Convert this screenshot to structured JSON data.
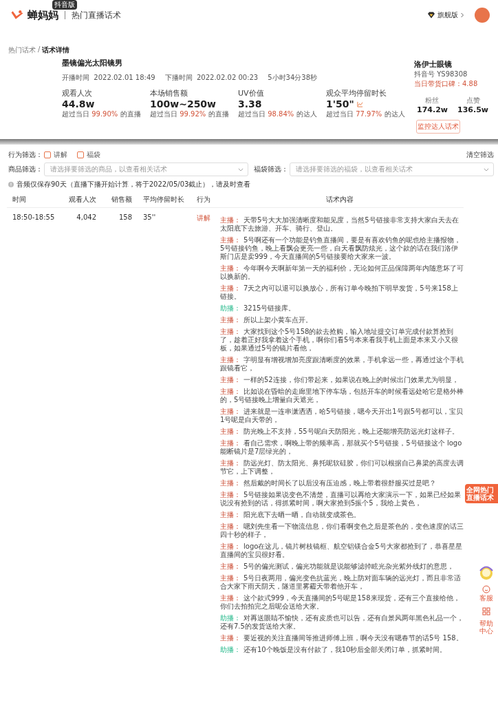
{
  "header": {
    "logo": "蝉妈妈",
    "edition_badge": "抖音版",
    "page_title": "热门直播话术",
    "plan": "旗舰版"
  },
  "breadcrumb": {
    "items": [
      "热门话术",
      "话术详情"
    ],
    "separator": "/"
  },
  "live": {
    "title": "墨镜偏光太阳镜男",
    "start_label": "开播时间",
    "start": "2022.02.01 18:49",
    "end_label": "下播时间",
    "end": "2022.02.02 00:23",
    "duration": "5小时34分38秒"
  },
  "metrics": [
    {
      "label": "观看人次",
      "value": "44.8w",
      "prefix": "超过当日",
      "percent": "99.90%",
      "suffix": "的直播",
      "trend": false
    },
    {
      "label": "本场销售额",
      "value": "100w~250w",
      "prefix": "超过当日",
      "percent": "99.92%",
      "suffix": "的直播",
      "trend": false
    },
    {
      "label": "UV价值",
      "value": "3.38",
      "prefix": "超过当日",
      "percent": "98.84%",
      "suffix": "的达人",
      "trend": false
    },
    {
      "label": "观众平均停留时长",
      "value": "1'50\"",
      "prefix": "超过当日",
      "percent": "77.97%",
      "suffix": "的达人",
      "trend": true
    }
  ],
  "streamer": {
    "name": "洛伊士眼镜",
    "account": "抖音号 YS98308",
    "rating": "当日带货口碑：4.88",
    "stats": [
      {
        "label": "粉丝",
        "value": "174.2w"
      },
      {
        "label": "点赞",
        "value": "136.5w"
      }
    ],
    "button": "监控达人话术"
  },
  "filters": {
    "behavior_label": "行为筛选：",
    "options": [
      {
        "label": "讲解",
        "checked": false
      },
      {
        "label": "福袋",
        "checked": false
      }
    ],
    "clear": "清空筛选",
    "product_label": "商品筛选：",
    "product_placeholder": "请选择要筛选的商品，以查看相关话术",
    "bag_label": "福袋筛选：",
    "bag_placeholder": "请选择要筛选的福袋，以查看相关话术"
  },
  "notice": "音频仅保存90天（直播下播开始计算，将于2022/05/03截止），请及时查看",
  "table": {
    "columns": [
      "时间",
      "观看人次",
      "销售额",
      "平均停留时长",
      "行为",
      "话术内容"
    ],
    "rows": [
      {
        "time": "18:50-18:55",
        "viewers": "4,042",
        "sales": "158",
        "avg_stay": "35''",
        "action": "讲解",
        "script": [
          {
            "speaker": "主播：",
            "kind": "host",
            "text": "天带5号大大加强清晰度和能见度，当然5号链接非常支持大家白天去在太阳底下去旅游、开车、骑行、登山。"
          },
          {
            "speaker": "主播：",
            "kind": "host",
            "text": "5号啊还有一个功能是钓鱼直播间，要是有喜欢钓鱼的呢也给主播报物，5号链接钓鱼，晚上看飘会更亮一些，白天看飘防炫光，这个款的话在我们洛伊斯门店是卖999，今天直播间的5号链接要给大家来一波。"
          },
          {
            "speaker": "主播：",
            "kind": "host",
            "text": "今年啊今天啊新年第一天的福利价，无论如何正品保障两年内随意坏了可以换新的。"
          },
          {
            "speaker": "主播：",
            "kind": "host",
            "text": "7天之内可以退可以换放心，所有订单今晚拍下明早发货，5号来158上链接。"
          },
          {
            "speaker": "助播：",
            "kind": "assistant",
            "text": "3215号链接库。"
          },
          {
            "speaker": "主播：",
            "kind": "host",
            "text": "所以上架小黄车点开。"
          },
          {
            "speaker": "主播：",
            "kind": "host",
            "text": "大家找到这个5号158的款去抢购，输入地址提交订单完成付款算抢到了，趁着正好我拿着这个手机，啊你们看5号本来看我手机上面是本来又小又很板，如果通过5号的镜片看他，"
          },
          {
            "speaker": "主播：",
            "kind": "host",
            "text": "字明显有增视增加亮度跟清晰度的效果，手机拿远一些，再通过这个手机跟镜看它，"
          },
          {
            "speaker": "主播：",
            "kind": "host",
            "text": "一样的52连接，你们带起来，如果说在晚上的时候出门效果尤为明显，"
          },
          {
            "speaker": "主播：",
            "kind": "host",
            "text": "比如说在昏暗的走廊里地下停车场，包括开车的时候看远处哈它是格外棒的，5号链接晚上增量白天遮光，"
          },
          {
            "speaker": "主播：",
            "kind": "host",
            "text": "进来就是一连串潇洒洒，哈5号链接，嗯今天开出1号跟5号都可以，宝贝1号呢是白天带的，"
          },
          {
            "speaker": "主播：",
            "kind": "host",
            "text": "防光晚上不支持，55号呢白天防阳光，晚上还能增亮防远光灯这样子。"
          },
          {
            "speaker": "主播：",
            "kind": "host",
            "text": "看自己需求，啊晚上带的频率高，那就买个5号链接，5号链接这个 logo能断镜片是7层绿光的，"
          },
          {
            "speaker": "主播：",
            "kind": "host",
            "text": "防远光灯、防太阳光、鼻托呢软硅胶，你们可以根据自己鼻梁的高度去调节它，上下调整，"
          },
          {
            "speaker": "主播：",
            "kind": "host",
            "text": "然后戴的时间长了以后没有压迫感，晚上带着很舒服买过是吧？"
          },
          {
            "speaker": "主播：",
            "kind": "host",
            "text": "5号链接如果说变色不清楚，直播可以再给大家演示一下，如果已经如果说没有抢到的话，得抓紧时间，啊大家抢到5振个5，我给上黄色，"
          },
          {
            "speaker": "主播：",
            "kind": "host",
            "text": "阳光底下去晒一晒，自动就变成茶色。"
          },
          {
            "speaker": "主播：",
            "kind": "host",
            "text": "嗯刘先生看一下物流信息，你们看啊变色之后是茶色的，变色速度的话三四十秒的样子，"
          },
          {
            "speaker": "主播：",
            "kind": "host",
            "text": "logo在这儿，镜片树枝镜框、航空铝镁合金5号大家都抢到了，恭喜星星直播间的宝贝很好看。"
          },
          {
            "speaker": "主播：",
            "kind": "host",
            "text": "5号的偏光测试，偏光功能就是说能够滤掉眩光杂光紫外线灯的意思，"
          },
          {
            "speaker": "主播：",
            "kind": "host",
            "text": "5号日夜两用，偏光变色抗蓝光，晚上防对面车辆的远光灯，而且非常适合大家下雨天阴天，隧道里雾霾天带着他开车，"
          },
          {
            "speaker": "主播：",
            "kind": "host",
            "text": "这个款式999，今天直播间的5号呢是158来现货，还有三个直接给他，你们去拍拍完之后呢会送给大家。"
          },
          {
            "speaker": "助播：",
            "kind": "assistant",
            "text": "对再送眼睛不愉快，还有皮质也可以告，还有自景风两年黑色礼品一个，还有7.5的发货送给大家。"
          },
          {
            "speaker": "主播：",
            "kind": "host",
            "text": "要近视的关注直播间等推进师傅上班，啊今天没有嗯春节的话5号 158。"
          },
          {
            "speaker": "助播：",
            "kind": "assistant",
            "text": "还有10个晚饭是没有付款了，我10秒后全部关闭订单，抓紧时间。"
          }
        ]
      }
    ]
  },
  "side_widgets": {
    "promo": [
      "全网热门",
      "直播话术"
    ],
    "service": "客服",
    "help": "帮助中心"
  }
}
